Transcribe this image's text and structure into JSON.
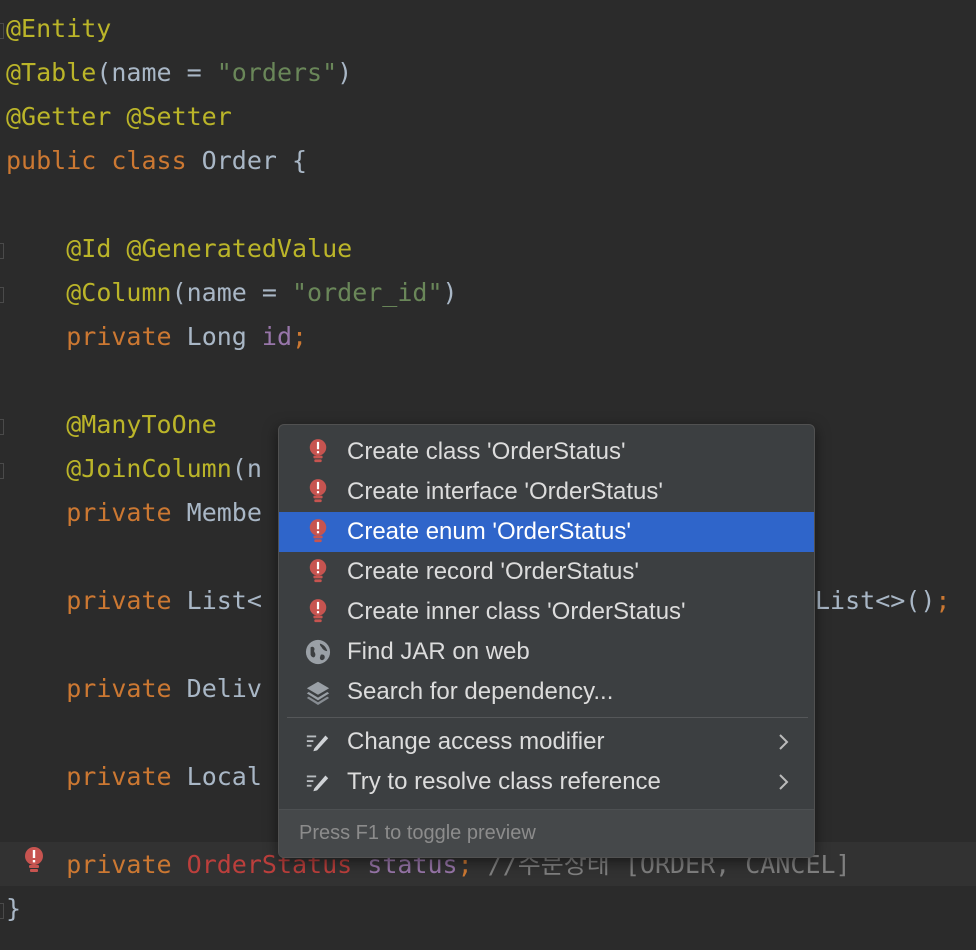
{
  "editor": {
    "lines": {
      "l1": {
        "a": "@Entity"
      },
      "l2": {
        "a": "@Table",
        "b": "(name = ",
        "c": "\"orders\"",
        "d": ")"
      },
      "l3": {
        "a": "@Getter @Setter"
      },
      "l4": {
        "a": "public class ",
        "b": "Order {"
      },
      "l6": {
        "indent": "    ",
        "a": "@Id @GeneratedValue"
      },
      "l7": {
        "indent": "    ",
        "a": "@Column",
        "b": "(name = ",
        "c": "\"order_id\"",
        "d": ")"
      },
      "l8": {
        "indent": "    ",
        "a": "private ",
        "b": "Long ",
        "c": "id",
        "d": ";"
      },
      "l10": {
        "indent": "    ",
        "a": "@ManyToOne"
      },
      "l11": {
        "indent": "    ",
        "a": "@JoinColumn",
        "b": "(n"
      },
      "l12": {
        "indent": "    ",
        "a": "private ",
        "b": "Membe"
      },
      "l14": {
        "indent": "    ",
        "a": "private ",
        "b": "List<",
        "c": "List<>()",
        "d": ";"
      },
      "l16": {
        "indent": "    ",
        "a": "private ",
        "b": "Deliv"
      },
      "l18": {
        "indent": "    ",
        "a": "private ",
        "b": "Local"
      },
      "l20": {
        "indent": "    ",
        "a": "private ",
        "b": "OrderStatus",
        "c": " status",
        "d": "; ",
        "e": "//주문상태 [ORDER, CANCEL]"
      },
      "l21": {
        "a": "}"
      }
    }
  },
  "popup": {
    "items": [
      {
        "label": "Create class 'OrderStatus'",
        "icon": "error-bulb-icon"
      },
      {
        "label": "Create interface 'OrderStatus'",
        "icon": "error-bulb-icon"
      },
      {
        "label": "Create enum 'OrderStatus'",
        "icon": "error-bulb-icon",
        "selected": true
      },
      {
        "label": "Create record 'OrderStatus'",
        "icon": "error-bulb-icon"
      },
      {
        "label": "Create inner class 'OrderStatus'",
        "icon": "error-bulb-icon"
      },
      {
        "label": "Find JAR on web",
        "icon": "globe-icon"
      },
      {
        "label": "Search for dependency...",
        "icon": "layers-icon"
      },
      {
        "label": "Change access modifier",
        "icon": "pencil-icon",
        "submenu": true
      },
      {
        "label": "Try to resolve class reference",
        "icon": "pencil-icon",
        "submenu": true
      }
    ],
    "footer": "Press F1 to toggle preview"
  },
  "colors": {
    "background": "#2b2b2b",
    "annotation": "#bbb529",
    "keyword": "#cc7832",
    "string": "#6a8759",
    "field": "#9876aa",
    "error": "#bc3f3c",
    "selection": "#2f65ca"
  }
}
